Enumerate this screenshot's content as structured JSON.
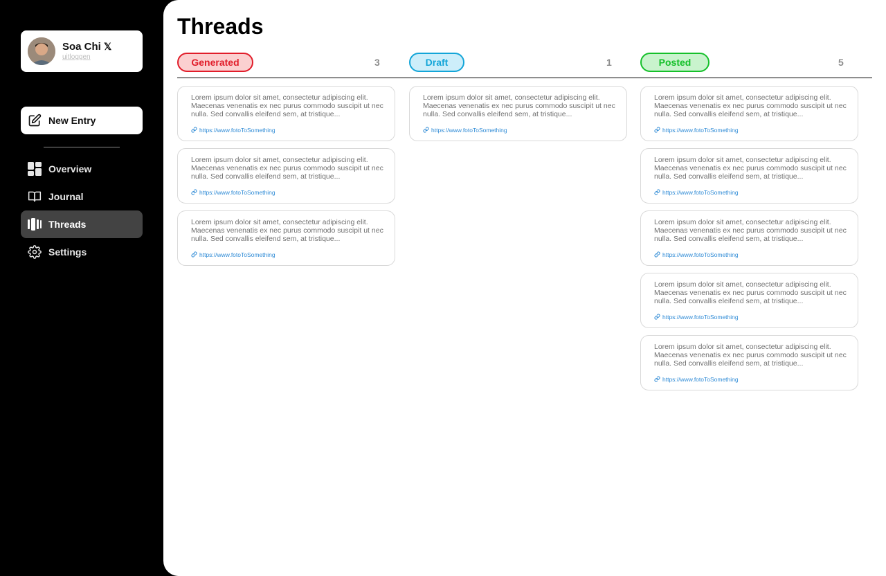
{
  "profile": {
    "name": "Soa Chi",
    "logout_label": "uitloggen",
    "social_icon": "x-icon"
  },
  "sidebar": {
    "new_entry_label": "New Entry",
    "items": [
      {
        "label": "Overview",
        "icon": "dashboard-icon",
        "active": false
      },
      {
        "label": "Journal",
        "icon": "book-icon",
        "active": false
      },
      {
        "label": "Threads",
        "icon": "threads-icon",
        "active": true
      },
      {
        "label": "Settings",
        "icon": "gear-icon",
        "active": false
      }
    ]
  },
  "page": {
    "title": "Threads"
  },
  "columns": [
    {
      "label": "Generated",
      "count": "3",
      "color": "#e11d2a",
      "bg": "#fbd0d0",
      "cards": [
        {
          "text": "Lorem ipsum dolor sit amet, consectetur adipiscing elit. Maecenas venenatis ex nec purus commodo suscipit ut nec nulla. Sed convallis eleifend sem, at tristique...",
          "link": "https://www.fotoToSomething"
        },
        {
          "text": "Lorem ipsum dolor sit amet, consectetur adipiscing elit. Maecenas venenatis ex nec purus commodo suscipit ut nec nulla. Sed convallis eleifend sem, at tristique...",
          "link": "https://www.fotoToSomething"
        },
        {
          "text": "Lorem ipsum dolor sit amet, consectetur adipiscing elit. Maecenas venenatis ex nec purus commodo suscipit ut nec nulla. Sed convallis eleifend sem, at tristique...",
          "link": "https://www.fotoToSomething"
        }
      ]
    },
    {
      "label": "Draft",
      "count": "1",
      "color": "#13a5d8",
      "bg": "#cdeefa",
      "cards": [
        {
          "text": "Lorem ipsum dolor sit amet, consectetur adipiscing elit. Maecenas venenatis ex nec purus commodo suscipit ut nec nulla. Sed convallis eleifend sem, at tristique...",
          "link": "https://www.fotoToSomething"
        }
      ]
    },
    {
      "label": "Posted",
      "count": "5",
      "color": "#15c02a",
      "bg": "#c9f3cd",
      "cards": [
        {
          "text": "Lorem ipsum dolor sit amet, consectetur adipiscing elit. Maecenas venenatis ex nec purus commodo suscipit ut nec nulla. Sed convallis eleifend sem, at tristique...",
          "link": "https://www.fotoToSomething"
        },
        {
          "text": "Lorem ipsum dolor sit amet, consectetur adipiscing elit. Maecenas venenatis ex nec purus commodo suscipit ut nec nulla. Sed convallis eleifend sem, at tristique...",
          "link": "https://www.fotoToSomething"
        },
        {
          "text": "Lorem ipsum dolor sit amet, consectetur adipiscing elit. Maecenas venenatis ex nec purus commodo suscipit ut nec nulla. Sed convallis eleifend sem, at tristique...",
          "link": "https://www.fotoToSomething"
        },
        {
          "text": "Lorem ipsum dolor sit amet, consectetur adipiscing elit. Maecenas venenatis ex nec purus commodo suscipit ut nec nulla. Sed convallis eleifend sem, at tristique...",
          "link": "https://www.fotoToSomething"
        },
        {
          "text": "Lorem ipsum dolor sit amet, consectetur adipiscing elit. Maecenas venenatis ex nec purus commodo suscipit ut nec nulla. Sed convallis eleifend sem, at tristique...",
          "link": "https://www.fotoToSomething"
        }
      ]
    }
  ]
}
